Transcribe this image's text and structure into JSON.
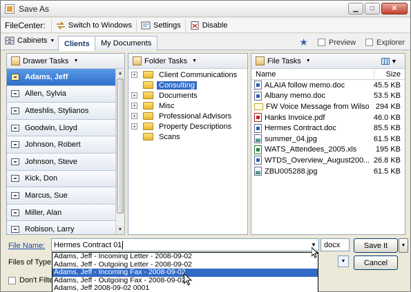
{
  "window": {
    "title": "Save As"
  },
  "toolbar": {
    "app_label": "FileCenter:",
    "switch_label": "Switch to Windows",
    "settings_label": "Settings",
    "disable_label": "Disable"
  },
  "tabs": {
    "cabinets_label": "Cabinets",
    "items": [
      {
        "label": "Clients"
      },
      {
        "label": "My Documents"
      }
    ],
    "preview_label": "Preview",
    "explorer_label": "Explorer"
  },
  "drawer_panel": {
    "header": "Drawer Tasks",
    "items": [
      {
        "label": "Adams, Jeff"
      },
      {
        "label": "Allen, Sylvia"
      },
      {
        "label": "Atteshlis, Stylianos"
      },
      {
        "label": "Goodwin, Lloyd"
      },
      {
        "label": "Johnson, Robert"
      },
      {
        "label": "Johnson, Steve"
      },
      {
        "label": "Kick, Don"
      },
      {
        "label": "Marcus, Sue"
      },
      {
        "label": "Miller, Alan"
      },
      {
        "label": "Robison, Larry"
      }
    ]
  },
  "folder_panel": {
    "header": "Folder Tasks",
    "items": [
      {
        "label": "Client Communications",
        "expander": "+"
      },
      {
        "label": "Consulting",
        "expander": ""
      },
      {
        "label": "Documents",
        "expander": "+"
      },
      {
        "label": "Misc",
        "expander": "+"
      },
      {
        "label": "Professional Advisors",
        "expander": "+"
      },
      {
        "label": "Property Descriptions",
        "expander": "+"
      },
      {
        "label": "Scans",
        "expander": ""
      }
    ]
  },
  "file_panel": {
    "header": "File Tasks",
    "col_name": "Name",
    "col_size": "Size",
    "files": [
      {
        "name": "ALAIA follow memo.doc",
        "size": "45.5 KB",
        "icon": "doc"
      },
      {
        "name": "Albany memo.doc",
        "size": "53.5 KB",
        "icon": "doc"
      },
      {
        "name": "FW Voice Message from Wilso...",
        "size": "294 KB",
        "icon": "msg"
      },
      {
        "name": "Hanks Invoice.pdf",
        "size": "46.0 KB",
        "icon": "pdf"
      },
      {
        "name": "Hermes Contract.doc",
        "size": "85.5 KB",
        "icon": "doc"
      },
      {
        "name": "summer_04.jpg",
        "size": "61.5 KB",
        "icon": "jpg"
      },
      {
        "name": "WATS_Attendees_2005.xls",
        "size": "195 KB",
        "icon": "xls"
      },
      {
        "name": "WTDS_Overview_August200...",
        "size": "26.8 KB",
        "icon": "doc"
      },
      {
        "name": "ZBU005288.jpg",
        "size": "61.5 KB",
        "icon": "jpg"
      }
    ]
  },
  "form": {
    "file_name_label": "File Name:",
    "file_name_value": "Hermes Contract 01",
    "extension_value": "docx",
    "file_type_label": "Files of Type:",
    "save_label": "Save It",
    "cancel_label": "Cancel",
    "dont_filter_label": "Don't Filter"
  },
  "autocomplete": {
    "items": [
      {
        "label": "Adams, Jeff - Incoming Letter - 2008-09-02"
      },
      {
        "label": "Adams, Jeff - Outgoing Letter - 2008-09-02"
      },
      {
        "label": "Adams, Jeff - Incoming Fax - 2008-09-02"
      },
      {
        "label": "Adams, Jeff - Outgoing Fax - 2008-09-02"
      },
      {
        "label": "Adams, Jeff 2008-09-02 0001"
      }
    ]
  }
}
